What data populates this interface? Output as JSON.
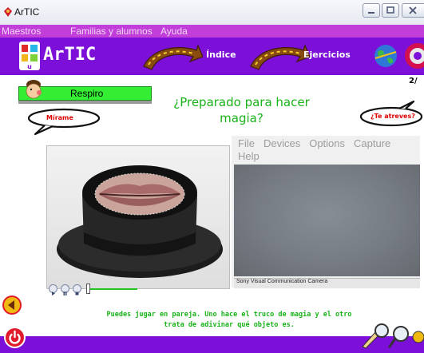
{
  "window": {
    "title": "ArTIC"
  },
  "menu": [
    "Maestros",
    "Familias y alumnos",
    "Ayuda"
  ],
  "toolbar": {
    "logo": "ArTIC",
    "indice": "Índice",
    "ejercicios": "Ejercicios"
  },
  "page": {
    "pager": "2/",
    "respiro_label": "Respiro",
    "heading": "¿Preparado para hacer magia?",
    "bubble_left": "Mírame",
    "bubble_right": "¿Te atreves?",
    "instructions": "Puedes jugar en pareja. Uno hace el truco de magia y el otro trata de adivinar qué objeto es."
  },
  "camera": {
    "menu": [
      "File",
      "Devices",
      "Options",
      "Capture",
      "Help"
    ],
    "status": "Sony Visual Communication Camera"
  },
  "player": {
    "progress": 0.0
  },
  "colors": {
    "menubar": "#c13ed9",
    "toolbar": "#7c0fd8",
    "accent_green": "#19b219",
    "respiro_bg": "#33ee33"
  }
}
